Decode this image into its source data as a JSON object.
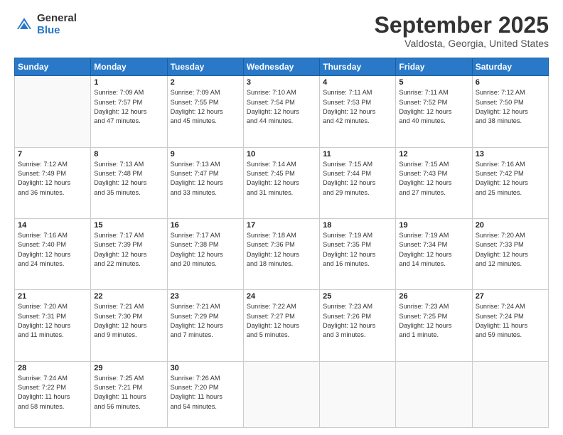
{
  "logo": {
    "general": "General",
    "blue": "Blue"
  },
  "title": "September 2025",
  "location": "Valdosta, Georgia, United States",
  "days_of_week": [
    "Sunday",
    "Monday",
    "Tuesday",
    "Wednesday",
    "Thursday",
    "Friday",
    "Saturday"
  ],
  "weeks": [
    [
      {
        "num": "",
        "info": ""
      },
      {
        "num": "1",
        "info": "Sunrise: 7:09 AM\nSunset: 7:57 PM\nDaylight: 12 hours\nand 47 minutes."
      },
      {
        "num": "2",
        "info": "Sunrise: 7:09 AM\nSunset: 7:55 PM\nDaylight: 12 hours\nand 45 minutes."
      },
      {
        "num": "3",
        "info": "Sunrise: 7:10 AM\nSunset: 7:54 PM\nDaylight: 12 hours\nand 44 minutes."
      },
      {
        "num": "4",
        "info": "Sunrise: 7:11 AM\nSunset: 7:53 PM\nDaylight: 12 hours\nand 42 minutes."
      },
      {
        "num": "5",
        "info": "Sunrise: 7:11 AM\nSunset: 7:52 PM\nDaylight: 12 hours\nand 40 minutes."
      },
      {
        "num": "6",
        "info": "Sunrise: 7:12 AM\nSunset: 7:50 PM\nDaylight: 12 hours\nand 38 minutes."
      }
    ],
    [
      {
        "num": "7",
        "info": "Sunrise: 7:12 AM\nSunset: 7:49 PM\nDaylight: 12 hours\nand 36 minutes."
      },
      {
        "num": "8",
        "info": "Sunrise: 7:13 AM\nSunset: 7:48 PM\nDaylight: 12 hours\nand 35 minutes."
      },
      {
        "num": "9",
        "info": "Sunrise: 7:13 AM\nSunset: 7:47 PM\nDaylight: 12 hours\nand 33 minutes."
      },
      {
        "num": "10",
        "info": "Sunrise: 7:14 AM\nSunset: 7:45 PM\nDaylight: 12 hours\nand 31 minutes."
      },
      {
        "num": "11",
        "info": "Sunrise: 7:15 AM\nSunset: 7:44 PM\nDaylight: 12 hours\nand 29 minutes."
      },
      {
        "num": "12",
        "info": "Sunrise: 7:15 AM\nSunset: 7:43 PM\nDaylight: 12 hours\nand 27 minutes."
      },
      {
        "num": "13",
        "info": "Sunrise: 7:16 AM\nSunset: 7:42 PM\nDaylight: 12 hours\nand 25 minutes."
      }
    ],
    [
      {
        "num": "14",
        "info": "Sunrise: 7:16 AM\nSunset: 7:40 PM\nDaylight: 12 hours\nand 24 minutes."
      },
      {
        "num": "15",
        "info": "Sunrise: 7:17 AM\nSunset: 7:39 PM\nDaylight: 12 hours\nand 22 minutes."
      },
      {
        "num": "16",
        "info": "Sunrise: 7:17 AM\nSunset: 7:38 PM\nDaylight: 12 hours\nand 20 minutes."
      },
      {
        "num": "17",
        "info": "Sunrise: 7:18 AM\nSunset: 7:36 PM\nDaylight: 12 hours\nand 18 minutes."
      },
      {
        "num": "18",
        "info": "Sunrise: 7:19 AM\nSunset: 7:35 PM\nDaylight: 12 hours\nand 16 minutes."
      },
      {
        "num": "19",
        "info": "Sunrise: 7:19 AM\nSunset: 7:34 PM\nDaylight: 12 hours\nand 14 minutes."
      },
      {
        "num": "20",
        "info": "Sunrise: 7:20 AM\nSunset: 7:33 PM\nDaylight: 12 hours\nand 12 minutes."
      }
    ],
    [
      {
        "num": "21",
        "info": "Sunrise: 7:20 AM\nSunset: 7:31 PM\nDaylight: 12 hours\nand 11 minutes."
      },
      {
        "num": "22",
        "info": "Sunrise: 7:21 AM\nSunset: 7:30 PM\nDaylight: 12 hours\nand 9 minutes."
      },
      {
        "num": "23",
        "info": "Sunrise: 7:21 AM\nSunset: 7:29 PM\nDaylight: 12 hours\nand 7 minutes."
      },
      {
        "num": "24",
        "info": "Sunrise: 7:22 AM\nSunset: 7:27 PM\nDaylight: 12 hours\nand 5 minutes."
      },
      {
        "num": "25",
        "info": "Sunrise: 7:23 AM\nSunset: 7:26 PM\nDaylight: 12 hours\nand 3 minutes."
      },
      {
        "num": "26",
        "info": "Sunrise: 7:23 AM\nSunset: 7:25 PM\nDaylight: 12 hours\nand 1 minute."
      },
      {
        "num": "27",
        "info": "Sunrise: 7:24 AM\nSunset: 7:24 PM\nDaylight: 11 hours\nand 59 minutes."
      }
    ],
    [
      {
        "num": "28",
        "info": "Sunrise: 7:24 AM\nSunset: 7:22 PM\nDaylight: 11 hours\nand 58 minutes."
      },
      {
        "num": "29",
        "info": "Sunrise: 7:25 AM\nSunset: 7:21 PM\nDaylight: 11 hours\nand 56 minutes."
      },
      {
        "num": "30",
        "info": "Sunrise: 7:26 AM\nSunset: 7:20 PM\nDaylight: 11 hours\nand 54 minutes."
      },
      {
        "num": "",
        "info": ""
      },
      {
        "num": "",
        "info": ""
      },
      {
        "num": "",
        "info": ""
      },
      {
        "num": "",
        "info": ""
      }
    ]
  ]
}
